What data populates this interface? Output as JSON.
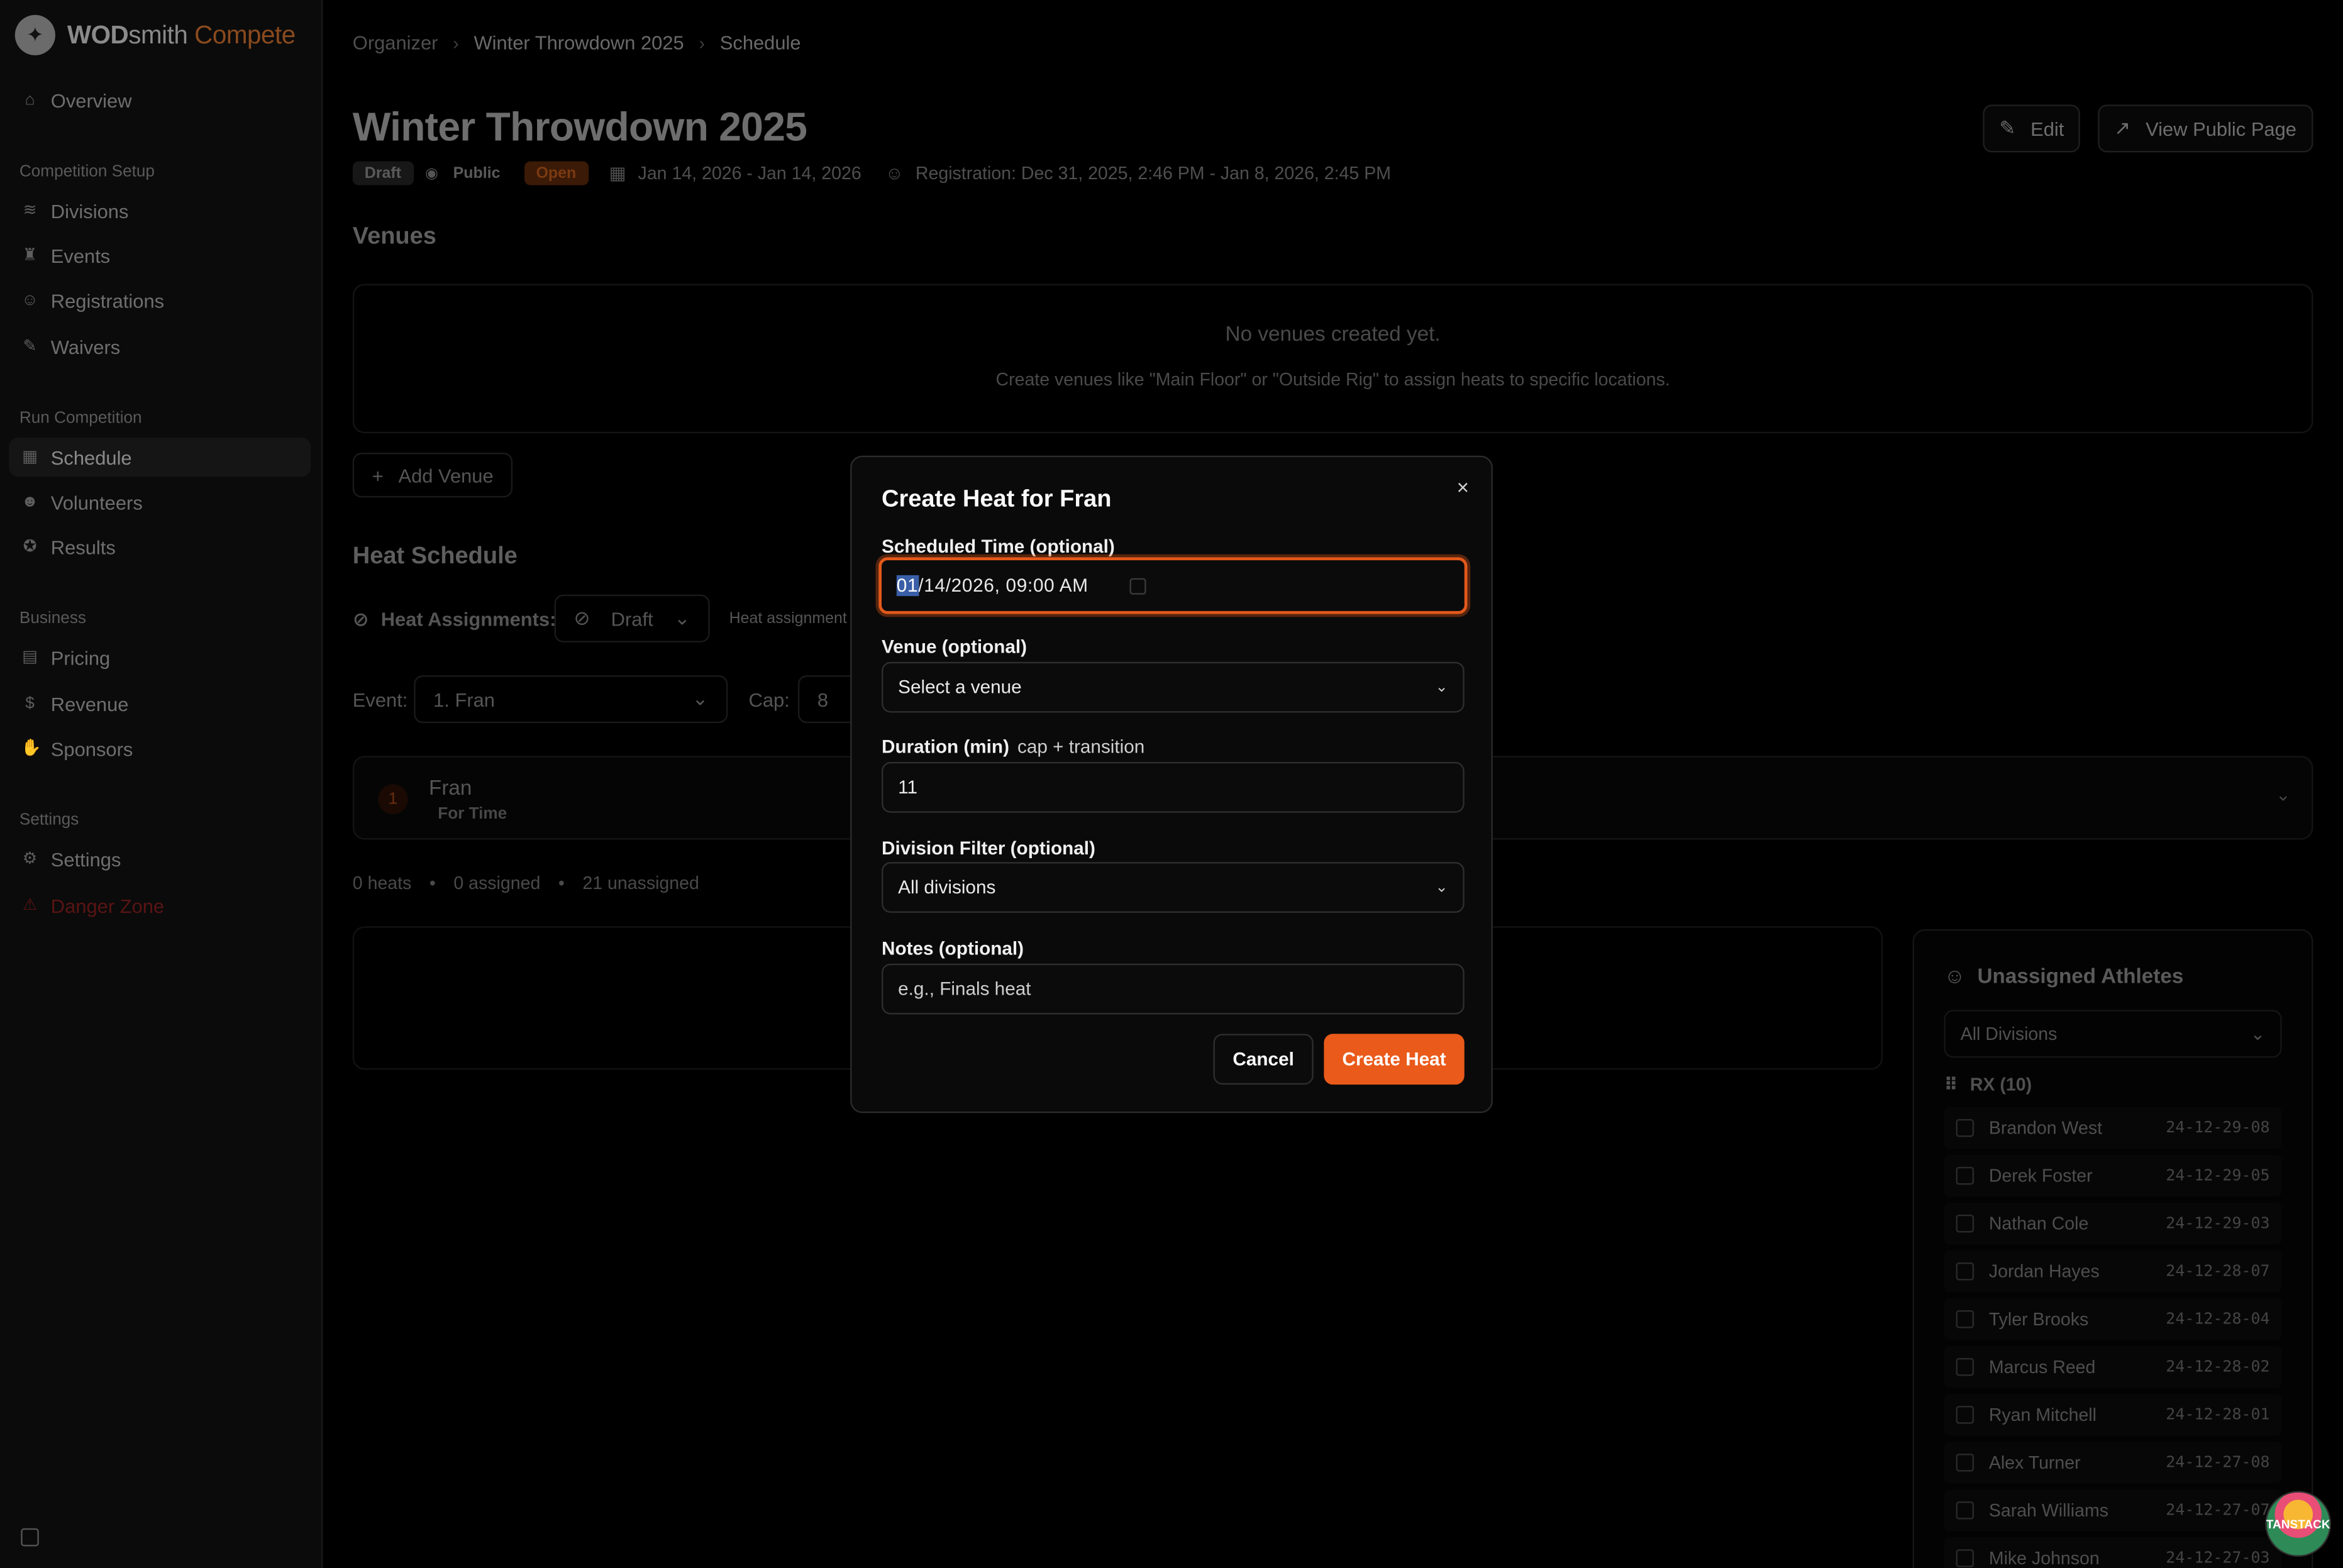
{
  "brand": {
    "name_bold": "WOD",
    "name_rest": "smith",
    "name_accent": "Compete",
    "accent_color": "#ea5a1a"
  },
  "sidebar": {
    "overview": "Overview",
    "sections": {
      "setup": "Competition Setup",
      "run": "Run Competition",
      "business": "Business",
      "settings": "Settings"
    },
    "items": {
      "divisions": "Divisions",
      "events": "Events",
      "registrations": "Registrations",
      "waivers": "Waivers",
      "schedule": "Schedule",
      "volunteers": "Volunteers",
      "results": "Results",
      "pricing": "Pricing",
      "revenue": "Revenue",
      "sponsors": "Sponsors",
      "settings": "Settings",
      "danger": "Danger Zone"
    }
  },
  "breadcrumb": {
    "organizer": "Organizer",
    "competition": "Winter Throwdown 2025",
    "current": "Schedule"
  },
  "header": {
    "title": "Winter Throwdown 2025",
    "edit": "Edit",
    "view_public": "View Public Page",
    "badges": {
      "draft": "Draft",
      "public": "Public",
      "open": "Open"
    },
    "dates": "Jan 14, 2026 - Jan 14, 2026",
    "registration": "Registration: Dec 31, 2025, 2:46 PM - Jan 8, 2026, 2:45 PM"
  },
  "venues": {
    "heading": "Venues",
    "empty_title": "No venues created yet.",
    "empty_body": "Create venues like \"Main Floor\" or \"Outside Rig\" to assign heats to specific locations.",
    "add": "Add Venue"
  },
  "heat_schedule": {
    "heading": "Heat Schedule",
    "assignments_label": "Heat Assignments:",
    "assignments_value": "Draft",
    "assignments_note": "Heat assignment",
    "event_label": "Event:",
    "event_value": "1. Fran",
    "cap_label": "Cap:",
    "cap_value": "8",
    "card_number": "1",
    "card_name": "Fran",
    "card_type": "For Time",
    "stats": {
      "heats": "0 heats",
      "assigned": "0 assigned",
      "unassigned": "21 unassigned",
      "dot": "•"
    }
  },
  "unassigned": {
    "title": "Unassigned Athletes",
    "filter": "All Divisions",
    "group": "RX (10)",
    "athletes": [
      {
        "name": "Brandon West",
        "date": "24-12-29-08"
      },
      {
        "name": "Derek Foster",
        "date": "24-12-29-05"
      },
      {
        "name": "Nathan Cole",
        "date": "24-12-29-03"
      },
      {
        "name": "Jordan Hayes",
        "date": "24-12-28-07"
      },
      {
        "name": "Tyler Brooks",
        "date": "24-12-28-04"
      },
      {
        "name": "Marcus Reed",
        "date": "24-12-28-02"
      },
      {
        "name": "Ryan Mitchell",
        "date": "24-12-28-01"
      },
      {
        "name": "Alex Turner",
        "date": "24-12-27-08"
      },
      {
        "name": "Sarah Williams",
        "date": "24-12-27-07"
      },
      {
        "name": "Mike Johnson",
        "date": "24-12-27-03"
      }
    ]
  },
  "modal": {
    "title": "Create Heat for Fran",
    "close": "×",
    "time_label": "Scheduled Time (optional)",
    "time_month": "01",
    "time_rest": "/14/2026, 09:00 AM",
    "venue_label": "Venue (optional)",
    "venue_value": "Select a venue",
    "duration_label": "Duration (min)",
    "duration_hint": "cap + transition",
    "duration_value": "11",
    "division_label": "Division Filter (optional)",
    "division_value": "All divisions",
    "notes_label": "Notes (optional)",
    "notes_placeholder": "e.g., Finals heat",
    "cancel": "Cancel",
    "create": "Create Heat"
  },
  "devtools_badge": "TANSTACK"
}
